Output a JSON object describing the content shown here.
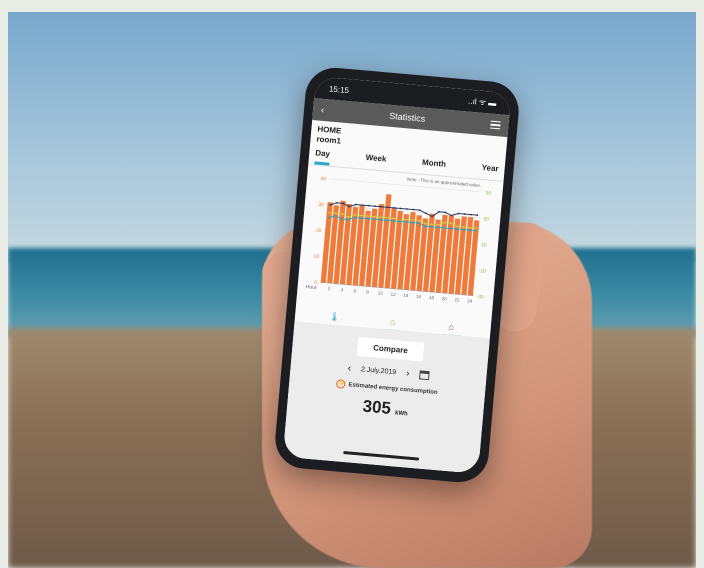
{
  "status": {
    "time": "15:15",
    "indicators": "..ıl ᯤ ▬"
  },
  "nav": {
    "back_icon": "chevron-left-icon",
    "title": "Statistics",
    "menu_icon": "hamburger-menu-icon"
  },
  "location": {
    "home": "HOME",
    "room": "room1"
  },
  "tabs": [
    {
      "label": "Day",
      "active": true
    },
    {
      "label": "Week",
      "active": false
    },
    {
      "label": "Month",
      "active": false
    },
    {
      "label": "Year",
      "active": false
    }
  ],
  "chart_note": "Note : This is an approximated value.",
  "chart_data": {
    "type": "bar",
    "xlabel": "Hour",
    "x_ticks": [
      "2",
      "4",
      "6",
      "8",
      "10",
      "12",
      "14",
      "16",
      "18",
      "20",
      "22",
      "24"
    ],
    "y_left_ticks": [
      "0",
      "10",
      "20",
      "30",
      "40"
    ],
    "y_right_ticks": [
      "-30",
      "-10",
      "10",
      "30",
      "50"
    ],
    "ylim": [
      0,
      40
    ],
    "categories": [
      "1",
      "2",
      "3",
      "4",
      "5",
      "6",
      "7",
      "8",
      "9",
      "10",
      "11",
      "12",
      "13",
      "14",
      "15",
      "16",
      "17",
      "18",
      "19",
      "20",
      "21",
      "22",
      "23",
      "24"
    ],
    "series": [
      {
        "type": "bar",
        "color": "#ef7a3a",
        "values": [
          31,
          30,
          32,
          31,
          30,
          31,
          29,
          30,
          32,
          36,
          31,
          30,
          29,
          30,
          29,
          28,
          30,
          28,
          30,
          30,
          29,
          30,
          30,
          29
        ]
      },
      {
        "type": "line",
        "color": "#2f3a66",
        "values": [
          30,
          31,
          31,
          30,
          31,
          31,
          31,
          31,
          31,
          31,
          31,
          31,
          31,
          31,
          31,
          30,
          29,
          31,
          31,
          30,
          31,
          31,
          31,
          31
        ]
      },
      {
        "type": "line",
        "color": "#c9d04b",
        "values": [
          27,
          27,
          27,
          26,
          27,
          27,
          27,
          27,
          27,
          27,
          27,
          26,
          27,
          27,
          27,
          26,
          26,
          26,
          27,
          27,
          26,
          26,
          26,
          26
        ]
      },
      {
        "type": "line",
        "color": "#26a6c8",
        "values": [
          25,
          26,
          25,
          25,
          26,
          26,
          26,
          26,
          26,
          26,
          26,
          26,
          26,
          26,
          26,
          25,
          25,
          25,
          25,
          25,
          25,
          25,
          25,
          25
        ]
      }
    ],
    "grid": true
  },
  "icons": [
    {
      "name": "thermometer-icon",
      "glyph": "🌡"
    },
    {
      "name": "house-icon",
      "glyph": "⌂"
    },
    {
      "name": "house-outdoor-icon",
      "glyph": "⌂"
    }
  ],
  "compare_label": "Compare",
  "date": "2.July.2019",
  "estimated_label": "Estimated energy consumption",
  "energy": {
    "value": "305",
    "unit": "kWh"
  },
  "colors": {
    "accent": "#26a6c8",
    "bar": "#ef7a3a",
    "nav": "#5a5a5a"
  }
}
